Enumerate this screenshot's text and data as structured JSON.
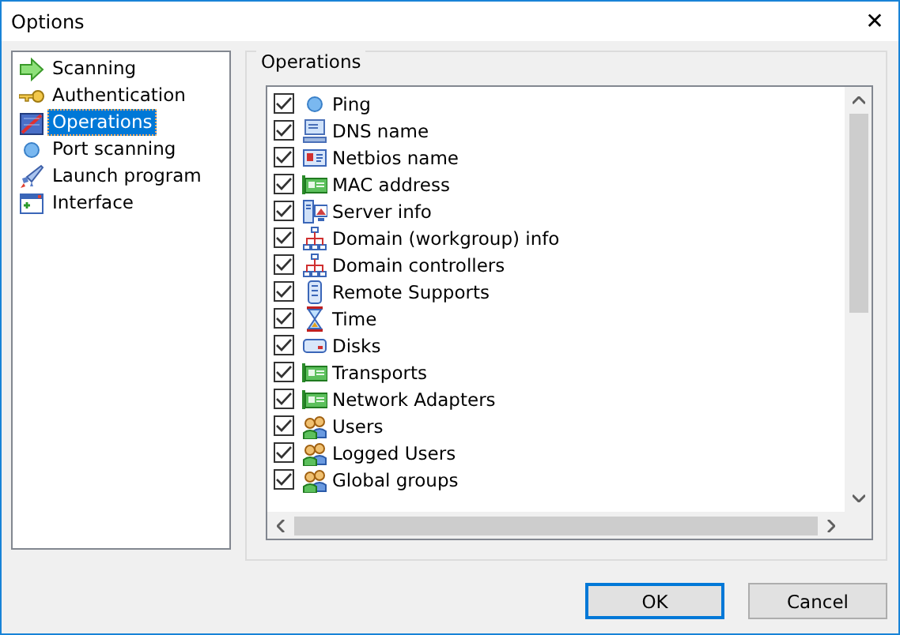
{
  "window": {
    "title": "Options",
    "close": "✕"
  },
  "sidebar": {
    "items": [
      {
        "label": "Scanning",
        "kind": "arrow",
        "selected": false
      },
      {
        "label": "Authentication",
        "kind": "key",
        "selected": false
      },
      {
        "label": "Operations",
        "kind": "chart",
        "selected": true
      },
      {
        "label": "Port scanning",
        "kind": "dot",
        "selected": false
      },
      {
        "label": "Launch program",
        "kind": "rocket",
        "selected": false
      },
      {
        "label": "Interface",
        "kind": "window",
        "selected": false
      }
    ]
  },
  "operations": {
    "title": "Operations",
    "items": [
      {
        "label": "Ping",
        "kind": "dot",
        "checked": true
      },
      {
        "label": "DNS name",
        "kind": "monitor",
        "checked": true
      },
      {
        "label": "Netbios name",
        "kind": "card",
        "checked": true
      },
      {
        "label": "MAC address",
        "kind": "board",
        "checked": true
      },
      {
        "label": "Server info",
        "kind": "server",
        "checked": true
      },
      {
        "label": "Domain (workgroup) info",
        "kind": "network",
        "checked": true
      },
      {
        "label": "Domain controllers",
        "kind": "network",
        "checked": true
      },
      {
        "label": "Remote Supports",
        "kind": "remote",
        "checked": true
      },
      {
        "label": "Time",
        "kind": "hourglass",
        "checked": true
      },
      {
        "label": "Disks",
        "kind": "disk",
        "checked": true
      },
      {
        "label": "Transports",
        "kind": "board",
        "checked": true
      },
      {
        "label": "Network Adapters",
        "kind": "board",
        "checked": true
      },
      {
        "label": "Users",
        "kind": "users",
        "checked": true
      },
      {
        "label": "Logged Users",
        "kind": "users",
        "checked": true
      },
      {
        "label": "Global groups",
        "kind": "users",
        "checked": true
      }
    ]
  },
  "buttons": [
    {
      "label": "OK",
      "default": true
    },
    {
      "label": "Cancel",
      "default": false
    }
  ]
}
